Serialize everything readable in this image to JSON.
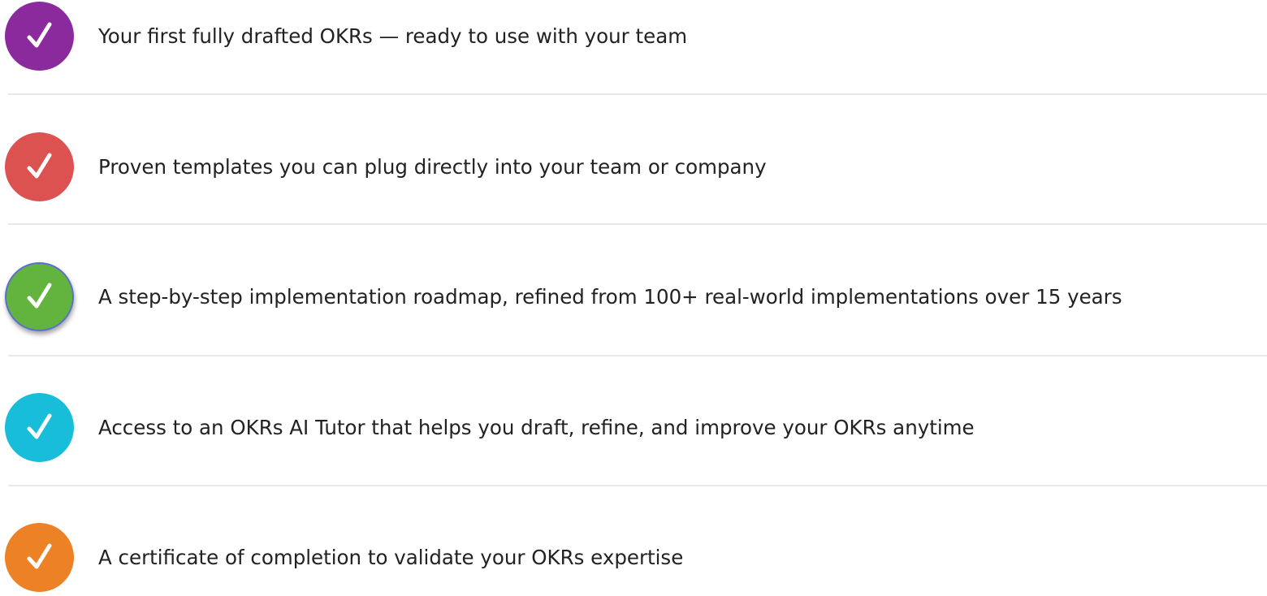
{
  "benefits": [
    {
      "text": "Your first fully drafted OKRs — ready to use with your team",
      "color": "#8b2a9c",
      "icon": "checkmark-icon"
    },
    {
      "text": "Proven templates you can plug directly into your team or company",
      "color": "#dc5250",
      "icon": "checkmark-icon"
    },
    {
      "text": "A step-by-step implementation roadmap, refined from 100+ real-world implementations over 15 years",
      "color": "#63b43f",
      "icon": "checkmark-icon"
    },
    {
      "text": "Access to an OKRs AI Tutor that helps you draft, refine, and improve your OKRs anytime",
      "color": "#17bdd9",
      "icon": "checkmark-icon"
    },
    {
      "text": "A certificate of completion to validate your OKRs expertise",
      "color": "#ec8126",
      "icon": "checkmark-icon"
    }
  ]
}
